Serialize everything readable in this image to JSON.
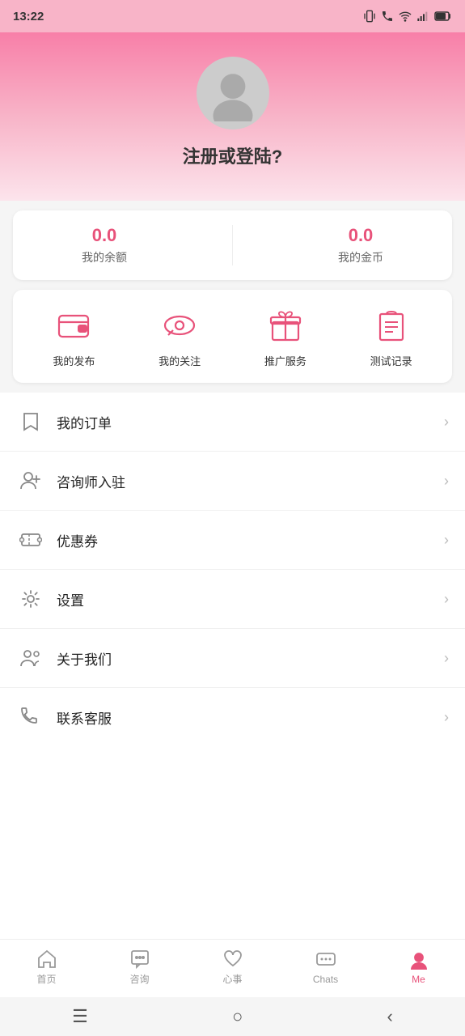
{
  "statusBar": {
    "time": "13:22"
  },
  "profile": {
    "prompt": "注册或登陆?"
  },
  "balance": {
    "amount": "0.0",
    "amountLabel": "我的余额",
    "coins": "0.0",
    "coinsLabel": "我的金币"
  },
  "quickActions": [
    {
      "id": "publish",
      "label": "我的发布",
      "icon": "wallet"
    },
    {
      "id": "follow",
      "label": "我的关注",
      "icon": "eye"
    },
    {
      "id": "promote",
      "label": "推广服务",
      "icon": "gift"
    },
    {
      "id": "test",
      "label": "测试记录",
      "icon": "clipboard"
    }
  ],
  "menuItems": [
    {
      "id": "orders",
      "label": "我的订单",
      "icon": "bookmark"
    },
    {
      "id": "consultant",
      "label": "咨询师入驻",
      "icon": "add-user"
    },
    {
      "id": "coupons",
      "label": "优惠券",
      "icon": "coupon"
    },
    {
      "id": "settings",
      "label": "设置",
      "icon": "gear"
    },
    {
      "id": "about",
      "label": "关于我们",
      "icon": "team"
    },
    {
      "id": "contact",
      "label": "联系客服",
      "icon": "phone"
    }
  ],
  "bottomNav": [
    {
      "id": "home",
      "label": "首页",
      "active": false
    },
    {
      "id": "consult",
      "label": "咨询",
      "active": false
    },
    {
      "id": "heart",
      "label": "心事",
      "active": false
    },
    {
      "id": "chats",
      "label": "Chats",
      "active": false
    },
    {
      "id": "me",
      "label": "Me",
      "active": true
    }
  ]
}
